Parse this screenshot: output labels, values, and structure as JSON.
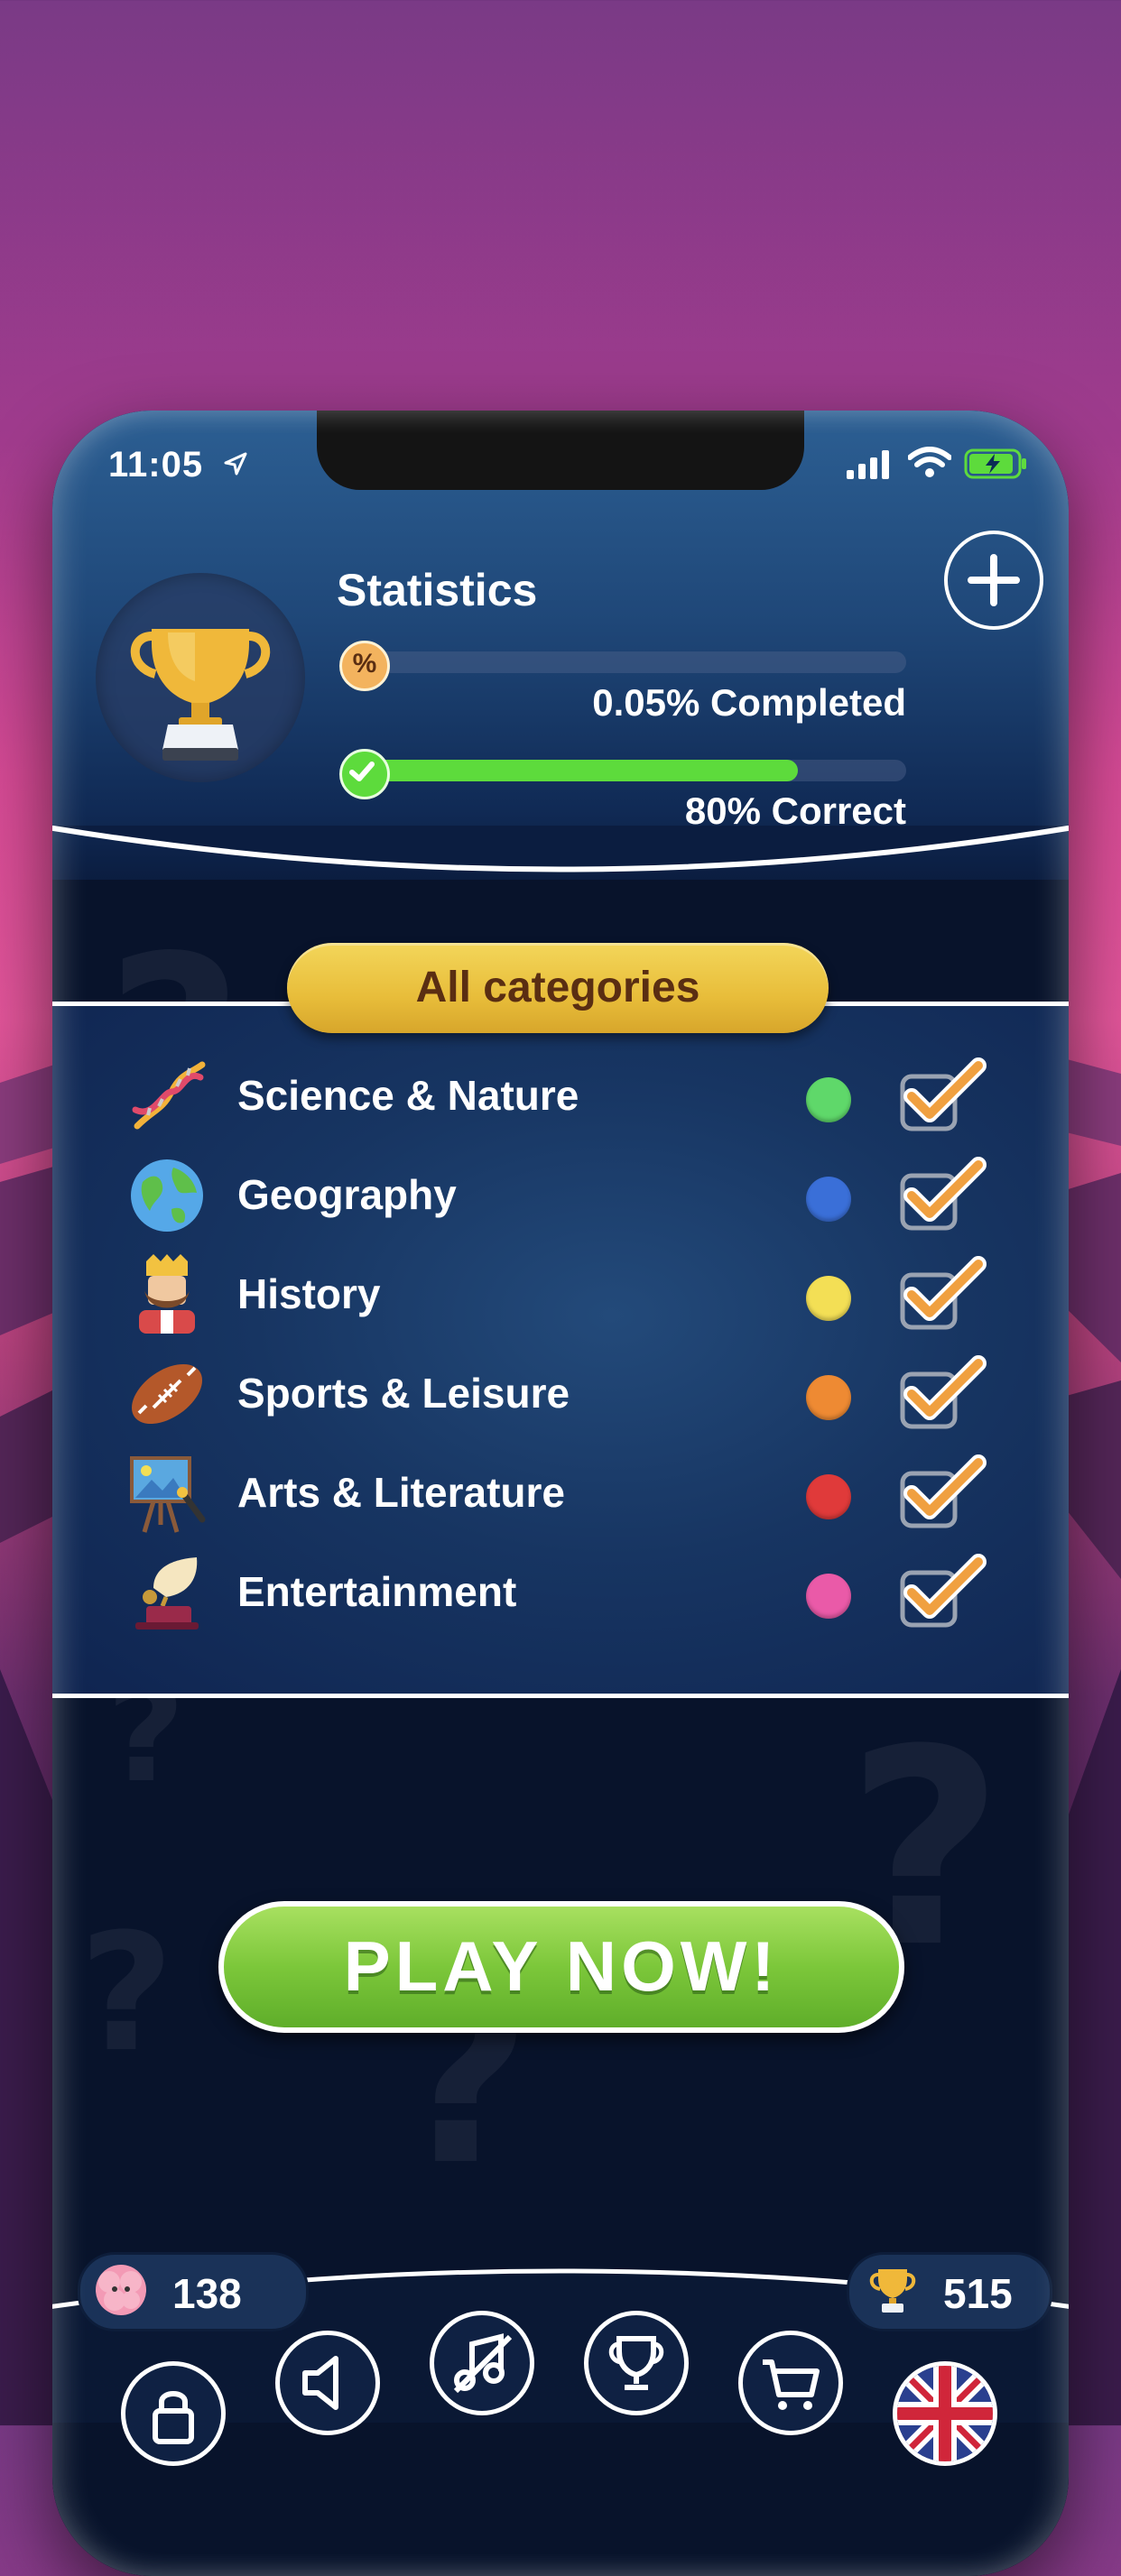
{
  "statusbar": {
    "time": "11:05"
  },
  "stats": {
    "title": "Statistics",
    "completed_badge": "%",
    "completed_fraction": 0.0005,
    "completed_text": "0.05% Completed",
    "correct_fraction": 0.8,
    "correct_text": "80% Correct"
  },
  "categories_header": "All categories",
  "categories": [
    {
      "label": "Science & Nature",
      "icon": "dna-icon",
      "color": "#5fd86a",
      "checked": true
    },
    {
      "label": "Geography",
      "icon": "globe-icon",
      "color": "#3a6fd8",
      "checked": true
    },
    {
      "label": "History",
      "icon": "king-icon",
      "color": "#f3df55",
      "checked": true
    },
    {
      "label": "Sports & Leisure",
      "icon": "football-icon",
      "color": "#ee8a33",
      "checked": true
    },
    {
      "label": "Arts & Literature",
      "icon": "painting-easel-icon",
      "color": "#e03a3a",
      "checked": true
    },
    {
      "label": "Entertainment",
      "icon": "gramophone-icon",
      "color": "#ea5aa8",
      "checked": true
    }
  ],
  "play_button": "PLAY NOW!",
  "footer": {
    "brains": "138",
    "trophies": "515"
  },
  "nav": [
    {
      "icon": "lock-icon"
    },
    {
      "icon": "speaker-icon"
    },
    {
      "icon": "music-icon"
    },
    {
      "icon": "trophy-icon"
    },
    {
      "icon": "cart-icon"
    },
    {
      "icon": "uk-flag-icon"
    }
  ],
  "colors": {
    "accent_gold": "#e8bd3a",
    "play_green": "#7cc73a",
    "panel_blue": "#173562"
  }
}
